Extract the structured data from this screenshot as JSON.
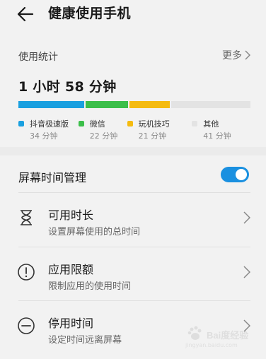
{
  "header": {
    "title": "健康使用手机"
  },
  "usage": {
    "section_label": "使用统计",
    "more_label": "更多",
    "total_time": "1 小时 58 分钟",
    "apps": [
      {
        "name": "抖音极速版",
        "time": "34 分钟",
        "minutes": 34,
        "color": "#1aa0e0"
      },
      {
        "name": "微信",
        "time": "22 分钟",
        "minutes": 22,
        "color": "#3cbf4a"
      },
      {
        "name": "玩机技巧",
        "time": "21 分钟",
        "minutes": 21,
        "color": "#f5bb10"
      },
      {
        "name": "其他",
        "time": "41 分钟",
        "minutes": 41,
        "color": "#e3e3e3"
      }
    ]
  },
  "screen_time": {
    "label": "屏幕时间管理",
    "toggle_on": true,
    "toggle_color": "#1a90e0"
  },
  "items": [
    {
      "title": "可用时长",
      "subtitle": "设置屏幕使用的总时间",
      "icon": "hourglass-icon"
    },
    {
      "title": "应用限额",
      "subtitle": "限制应用的使用时间",
      "icon": "alert-circle-icon"
    },
    {
      "title": "停用时间",
      "subtitle": "设定时间远离屏幕",
      "icon": "minus-circle-icon"
    }
  ],
  "watermark": {
    "text": "Bai度经验",
    "url": "jingyan.baidu.com"
  }
}
